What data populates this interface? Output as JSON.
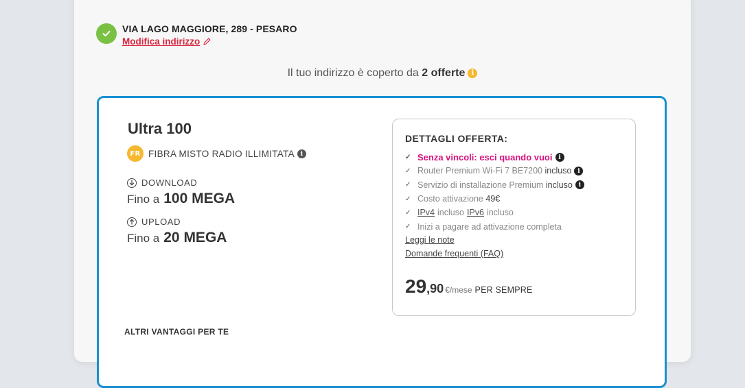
{
  "address": {
    "line": "VIA LAGO MAGGIORE, 289 - PESARO",
    "modify_label": "Modifica indirizzo"
  },
  "coverage": {
    "prefix": "Il tuo indirizzo è coperto da",
    "count_label": "2 offerte"
  },
  "offer": {
    "name": "Ultra 100",
    "tech_badge": "FR",
    "tech_label": "FIBRA MISTO RADIO ILLIMITATA",
    "download": {
      "label": "DOWNLOAD",
      "prefix": "Fino a",
      "value": "100 MEGA"
    },
    "upload": {
      "label": "UPLOAD",
      "prefix": "Fino a",
      "value": "20 MEGA"
    },
    "more_advantages": "ALTRI VANTAGGI PER TE",
    "details": {
      "title": "DETTAGLI OFFERTA:",
      "no_commitment": "Senza vincoli: esci quando vuoi",
      "router": {
        "text": "Router Premium Wi-Fi 7 BE7200",
        "suffix": "incluso"
      },
      "install": {
        "text": "Servizio di installazione Premium",
        "suffix": "incluso"
      },
      "activation": {
        "text": "Costo attivazione",
        "value": "49€"
      },
      "ip": {
        "ipv4": "IPv4",
        "incl1": "incluso",
        "ipv6": "IPv6",
        "incl2": "incluso"
      },
      "pay_start": "Inizi a pagare ad attivazione completa",
      "notes_link": "Leggi le note",
      "faq_link": "Domande frequenti (FAQ)",
      "price_int": "29",
      "price_dec": ",90",
      "price_unit": "€/mese",
      "price_forever": "PER SEMPRE"
    }
  },
  "colors": {
    "accent_blue": "#1a8fd0",
    "success_green": "#7ac143",
    "link_red": "#d9263f",
    "magenta": "#d4137e",
    "info_yellow": "#f5b82e"
  }
}
